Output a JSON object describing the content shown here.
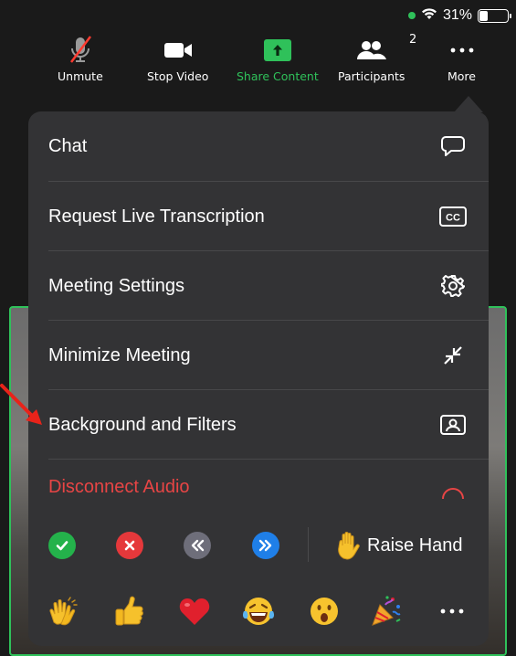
{
  "status_bar": {
    "battery_percent": "31%"
  },
  "toolbar": {
    "unmute": "Unmute",
    "stop_video": "Stop Video",
    "share_content": "Share Content",
    "participants": "Participants",
    "participants_count": "2",
    "more": "More"
  },
  "menu": {
    "items": [
      {
        "label": "Chat",
        "icon": "chat-bubble-icon"
      },
      {
        "label": "Request Live Transcription",
        "icon": "cc-icon"
      },
      {
        "label": "Meeting Settings",
        "icon": "gear-icon"
      },
      {
        "label": "Minimize Meeting",
        "icon": "minimize-arrows-icon"
      },
      {
        "label": "Background and Filters",
        "icon": "background-portrait-icon"
      },
      {
        "label": "Disconnect Audio",
        "icon": "disconnect-audio-icon"
      }
    ]
  },
  "reactions": {
    "raise_hand": "Raise Hand",
    "buttons": [
      "yes-check",
      "no-x",
      "slower-rewind",
      "faster-forward"
    ]
  },
  "emojis": [
    "clapping-hands",
    "thumbs-up",
    "heart",
    "tears-of-joy",
    "open-mouth",
    "party-popper",
    "more-ellipsis"
  ],
  "colors": {
    "accent_green": "#2fc15a",
    "menu_bg": "#333335",
    "danger_red": "#e84545",
    "annotation_arrow": "#e8231a"
  }
}
